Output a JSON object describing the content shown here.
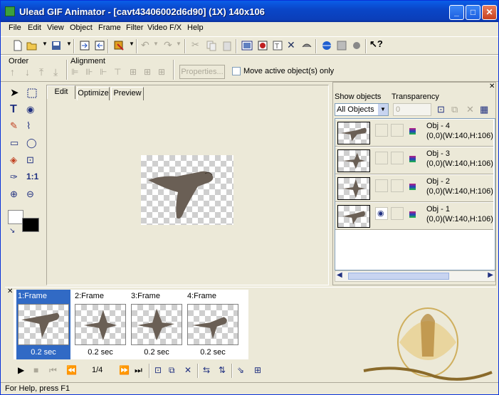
{
  "window": {
    "title": "Ulead GIF Animator - [cavt43406002d6d90] (1X) 140x106",
    "minimize": "_",
    "maximize": "□",
    "close": "✕"
  },
  "menu": [
    "File",
    "Edit",
    "View",
    "Object",
    "Frame",
    "Filter",
    "Video F/X",
    "Help"
  ],
  "order_toolbar": {
    "order_label": "Order",
    "alignment_label": "Alignment",
    "properties_label": "Properties...",
    "move_active_label": "Move active object(s) only",
    "move_active_checked": false
  },
  "canvas_tabs": [
    "Edit",
    "Optimize",
    "Preview"
  ],
  "active_tab": "Edit",
  "object_manager": {
    "show_objects_label": "Show objects",
    "transparency_label": "Transparency",
    "show_objects_value": "All Objects",
    "transparency_value": "0",
    "objects": [
      {
        "name": "Obj - 4",
        "dims": "(0,0)(W:140,H:106)",
        "visible": false
      },
      {
        "name": "Obj - 3",
        "dims": "(0,0)(W:140,H:106)",
        "visible": false
      },
      {
        "name": "Obj - 2",
        "dims": "(0,0)(W:140,H:106)",
        "visible": false
      },
      {
        "name": "Obj - 1",
        "dims": "(0,0)(W:140,H:106)",
        "visible": true
      }
    ]
  },
  "frames": [
    {
      "label": "1:Frame",
      "delay": "0.2 sec",
      "selected": true
    },
    {
      "label": "2:Frame",
      "delay": "0.2 sec",
      "selected": false
    },
    {
      "label": "3:Frame",
      "delay": "0.2 sec",
      "selected": false
    },
    {
      "label": "4:Frame",
      "delay": "0.2 sec",
      "selected": false
    }
  ],
  "playback": {
    "frame_counter": "1/4"
  },
  "status_bar": {
    "text": "For Help, press F1"
  },
  "colors": {
    "title_blue": "#0a46c8",
    "selection_blue": "#316ac5",
    "watermark_gold": "#c8a040"
  }
}
